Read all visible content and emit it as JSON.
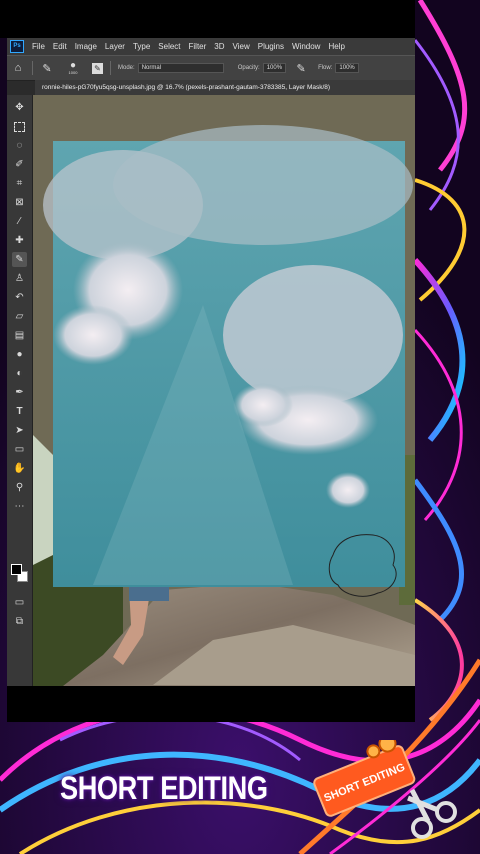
{
  "app": {
    "logo": "Ps",
    "menu": [
      "File",
      "Edit",
      "Image",
      "Layer",
      "Type",
      "Select",
      "Filter",
      "3D",
      "View",
      "Plugins",
      "Window",
      "Help"
    ]
  },
  "options": {
    "mode_label": "Mode:",
    "mode_value": "Normal",
    "opacity_label": "Opacity:",
    "opacity_value": "100%",
    "flow_label": "Flow:",
    "flow_value": "100%",
    "brush_size": "1000"
  },
  "document": {
    "tab_title": "ronnie-hiles-pG70fyu5qsg-unsplash.jpg @ 16.7% (pexels-prashant-gautam-3783385, Layer Mask/8)"
  },
  "tools": [
    "move-icon",
    "marquee-icon",
    "lasso-icon",
    "quick-select-icon",
    "crop-icon",
    "frame-icon",
    "eyedropper-icon",
    "healing-icon",
    "brush-icon",
    "stamp-icon",
    "history-brush-icon",
    "eraser-icon",
    "gradient-icon",
    "blur-icon",
    "dodge-icon",
    "pen-icon",
    "type-icon",
    "path-select-icon",
    "rectangle-icon",
    "hand-icon",
    "zoom-icon",
    "more-icon"
  ],
  "colors": {
    "foreground": "#000000",
    "background": "#ffffff",
    "sky": "#4a98a6",
    "accent": "#ff5a1f"
  },
  "overlay": {
    "caption": "SHORT EDITING",
    "badge_text": "SHORT EDITING"
  }
}
